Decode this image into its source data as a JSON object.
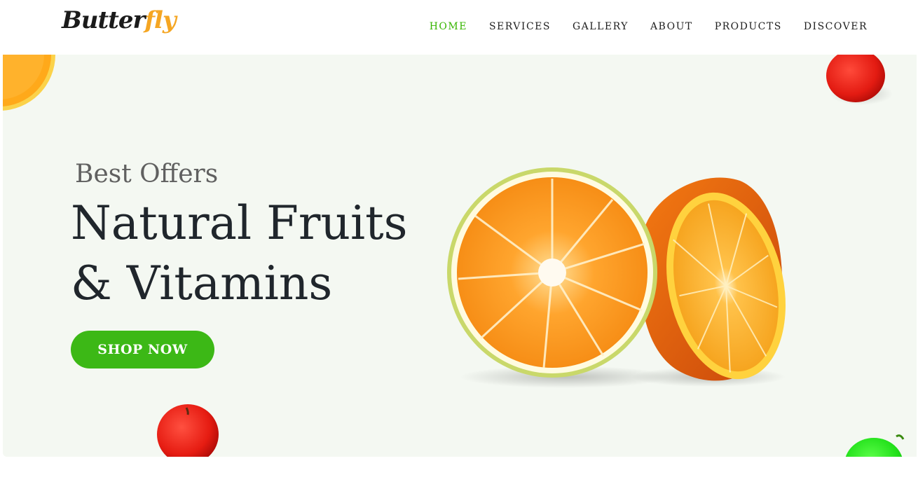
{
  "header": {
    "logo": {
      "main": "Butter",
      "accent": "fly"
    },
    "nav": [
      {
        "label": "HOME",
        "active": true
      },
      {
        "label": "SERVICES",
        "active": false
      },
      {
        "label": "GALLERY",
        "active": false
      },
      {
        "label": "ABOUT",
        "active": false
      },
      {
        "label": "PRODUCTS",
        "active": false
      },
      {
        "label": "DISCOVER",
        "active": false
      }
    ]
  },
  "hero": {
    "eyebrow": "Best Offers",
    "title_line1": "Natural Fruits",
    "title_line2": "& Vitamins",
    "cta_label": "SHOP NOW",
    "images": [
      "orange-slice-top-left",
      "apple-top-right",
      "orange-halves",
      "apple-bottom-left",
      "green-apple-bottom-right"
    ]
  },
  "colors": {
    "accent_green": "#3cb816",
    "nav_active": "#36b500",
    "logo_accent": "#f5a623",
    "hero_bg": "#f4f8f2",
    "heading": "#20262c"
  }
}
